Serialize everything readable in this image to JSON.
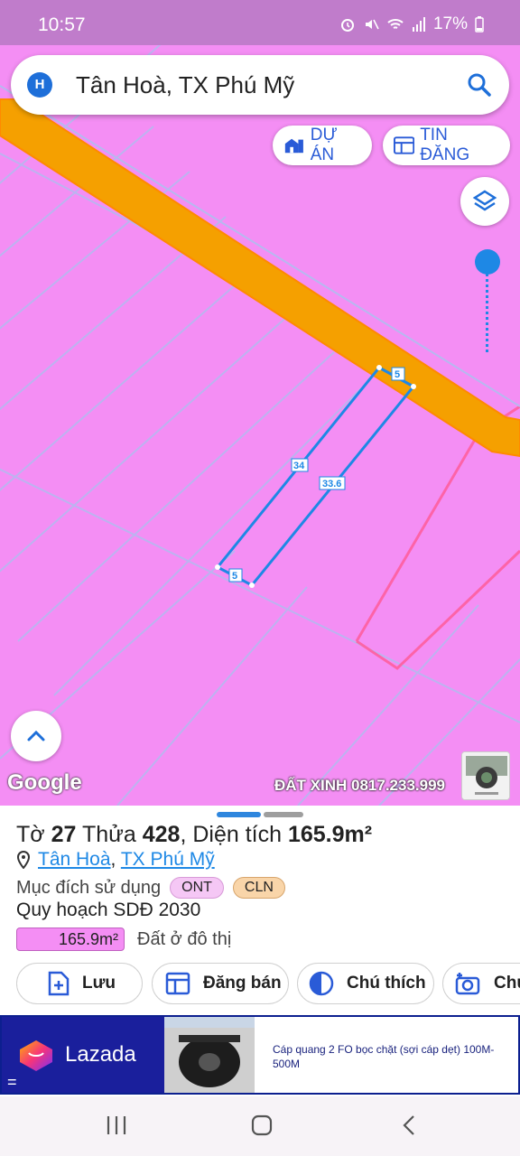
{
  "status_bar": {
    "time": "10:57",
    "battery": "17%",
    "icons": [
      "alarm-icon",
      "mute-icon",
      "wifi-icon",
      "signal-icon",
      "battery-icon"
    ]
  },
  "search": {
    "avatar_letter": "H",
    "query": "Tân Hoà, TX Phú Mỹ",
    "icon": "search-icon"
  },
  "map": {
    "buttons": {
      "du_an": "DỰ ÁN",
      "tin_dang": "TIN ĐĂNG"
    },
    "parcel_dimensions": {
      "top": "5",
      "left": "34",
      "right": "33.6",
      "bottom": "5"
    },
    "provider": "Google",
    "watermark": "ĐẤT XINH 0817.233.999",
    "colors": {
      "land_fill": "#f48ef4",
      "road": "#f5a000",
      "parcel_outline": "#1e88e5"
    }
  },
  "parcel": {
    "sheet_label": "Tờ",
    "sheet_no": "27",
    "lot_label": "Thửa",
    "lot_no": "428",
    "area_label": ", Diện tích",
    "area": "165.9m²",
    "location": {
      "ward": "Tân Hoà",
      "town": "TX Phú Mỹ"
    },
    "purpose_label": "Mục đích sử dụng",
    "purpose_tags": [
      "ONT",
      "CLN"
    ],
    "plan_title": "Quy hoạch SDĐ 2030",
    "plan_area": "165.9m²",
    "plan_type": "Đất ở đô thị"
  },
  "actions": {
    "save": "Lưu",
    "sell": "Đăng bán",
    "legend": "Chú thích",
    "photo": "Chụ"
  },
  "ad": {
    "brand": "Lazada",
    "eq": "=",
    "text": "Cáp quang 2 FO bọc chặt (sợi cáp dẹt) 100M-500M"
  }
}
